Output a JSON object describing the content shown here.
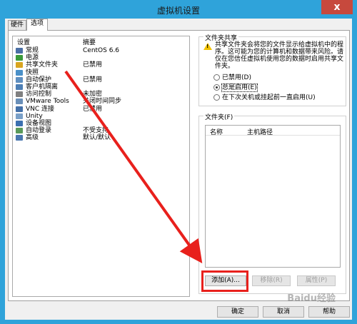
{
  "window": {
    "title": "虚拟机设置",
    "close_glyph": "x"
  },
  "tabs": [
    {
      "label": "硬件"
    },
    {
      "label": "选项"
    }
  ],
  "list": {
    "header_setting": "设置",
    "header_summary": "摘要",
    "rows": [
      {
        "name": "常规",
        "summary": "CentOS 6.6",
        "icon": "general-icon",
        "color": "#4a6fa5"
      },
      {
        "name": "电源",
        "summary": "",
        "icon": "power-icon",
        "color": "#3a9a3a"
      },
      {
        "name": "共享文件夹",
        "summary": "已禁用",
        "icon": "shared-folder-icon",
        "color": "#d9a520"
      },
      {
        "name": "快照",
        "summary": "",
        "icon": "snapshot-icon",
        "color": "#4a90c8"
      },
      {
        "name": "自动保护",
        "summary": "已禁用",
        "icon": "autoprotect-icon",
        "color": "#5f8fc0"
      },
      {
        "name": "客户机隔离",
        "summary": "",
        "icon": "isolation-icon",
        "color": "#4d7fb5"
      },
      {
        "name": "访问控制",
        "summary": "未加密",
        "icon": "access-control-icon",
        "color": "#808080"
      },
      {
        "name": "VMware Tools",
        "summary": "关闭时间同步",
        "icon": "vmware-tools-icon",
        "color": "#6a8fb8"
      },
      {
        "name": "VNC 连接",
        "summary": "已禁用",
        "icon": "vnc-icon",
        "color": "#4470a8"
      },
      {
        "name": "Unity",
        "summary": "",
        "icon": "unity-icon",
        "color": "#7aa0c8"
      },
      {
        "name": "设备视图",
        "summary": "",
        "icon": "device-view-icon",
        "color": "#3c70b0"
      },
      {
        "name": "自动登录",
        "summary": "不受支持",
        "icon": "autologin-icon",
        "color": "#5a9a5a"
      },
      {
        "name": "高级",
        "summary": "默认/默认",
        "icon": "advanced-icon",
        "color": "#4a78b0"
      }
    ]
  },
  "share": {
    "group_title": "文件夹共享",
    "warning": "共享文件夹会将您的文件显示给虚拟机中的程序。这可能为您的计算机和数据带来风险。请仅在您信任虚拟机使用您的数据时启用共享文件夹。",
    "options": [
      {
        "label": "已禁用(D)",
        "checked": false
      },
      {
        "label": "总是启用(E)",
        "checked": true
      },
      {
        "label": "在下次关机或挂起前一直启用(U)",
        "checked": false
      }
    ]
  },
  "folders": {
    "group_title": "文件夹(F)",
    "col_name": "名称",
    "col_path": "主机路径",
    "add_label": "添加(A)...",
    "remove_label": "移除(R)",
    "properties_label": "属性(P)"
  },
  "footer": {
    "ok_label": "确定",
    "cancel_label": "取消",
    "help_label": "帮助"
  },
  "watermark": "Baidu经验",
  "colors": {
    "title_bar": "#2fa3da",
    "close": "#c7493d",
    "annotation": "#e8201c"
  }
}
